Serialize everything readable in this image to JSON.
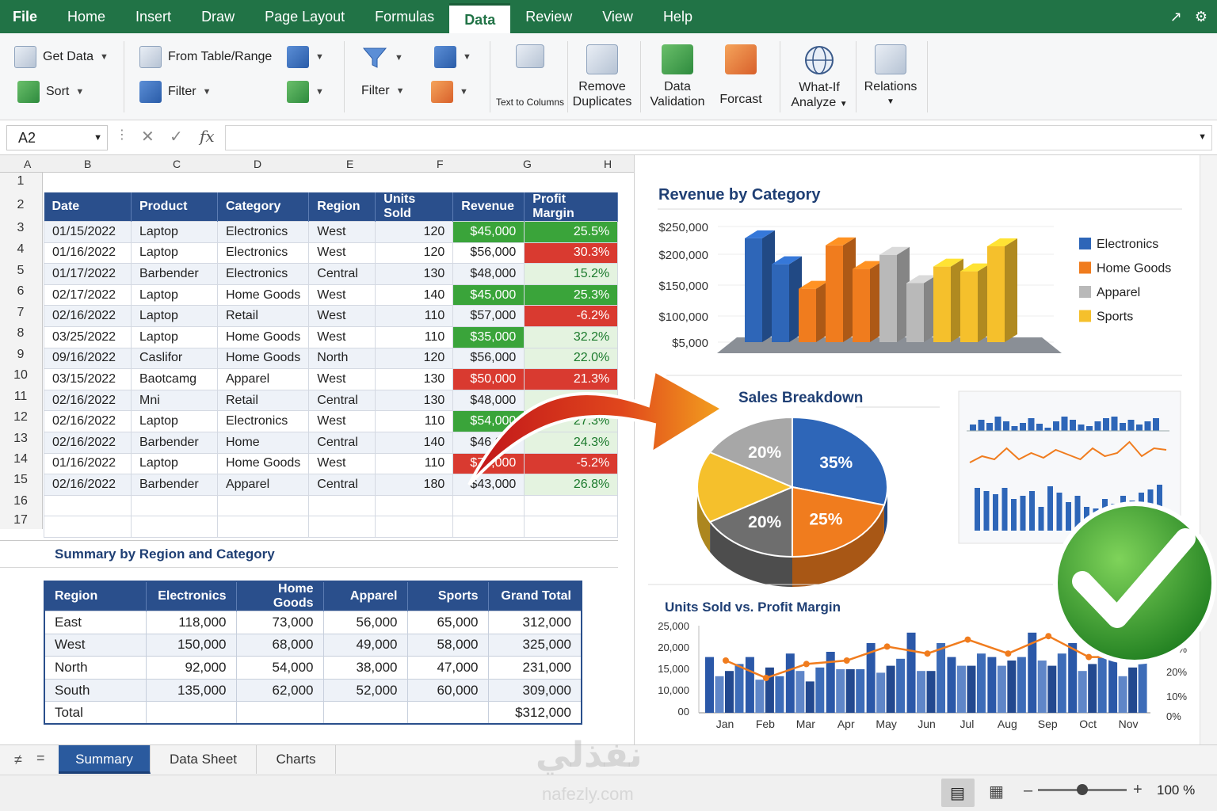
{
  "menu": {
    "tabs": [
      "File",
      "Home",
      "Insert",
      "Draw",
      "Page Layout",
      "Formulas",
      "Data",
      "Review",
      "View",
      "Help"
    ],
    "active": "Data"
  },
  "ribbon": {
    "get_data": "Get Data",
    "sort": "Sort",
    "from_table": "From Table/Range",
    "filter_small": "Filter",
    "filter": "Filter",
    "text_to_columns": "Text to Columns",
    "remove_duplicates_1": "Remove",
    "remove_duplicates_2": "Duplicates",
    "data_validation_1": "Data",
    "data_validation_2": "Validation",
    "forecast": "Forcast",
    "whatif_1": "What-If",
    "whatif_2": "Analyze",
    "relations": "Relations"
  },
  "formula_bar": {
    "name_box": "A2",
    "fx": "fx",
    "formula": ""
  },
  "columns": [
    "A",
    "B",
    "C",
    "D",
    "E",
    "F",
    "G",
    "H"
  ],
  "rows": [
    "1",
    "2",
    "3",
    "4",
    "5",
    "6",
    "7",
    "8",
    "9",
    "10",
    "11",
    "12",
    "13",
    "14",
    "15",
    "16",
    "17"
  ],
  "data_table": {
    "headers": [
      "Date",
      "Product",
      "Category",
      "Region",
      "Units Sold",
      "Revenue",
      "Profit Margin"
    ],
    "rows": [
      [
        "01/15/2022",
        "Laptop",
        "Electronics",
        "West",
        "120",
        "$45,000",
        "25.5%"
      ],
      [
        "01/16/2022",
        "Laptop",
        "Electronics",
        "West",
        "120",
        "$56,000",
        "30.3%"
      ],
      [
        "01/17/2022",
        "Barbender",
        "Electronics",
        "Central",
        "130",
        "$48,000",
        "15.2%"
      ],
      [
        "02/17/2022",
        "Laptop",
        "Home Goods",
        "West",
        "140",
        "$45,000",
        "25.3%"
      ],
      [
        "02/16/2022",
        "Laptop",
        "Retail",
        "West",
        "110",
        "$57,000",
        "-6.2%"
      ],
      [
        "03/25/2022",
        "Laptop",
        "Home Goods",
        "West",
        "110",
        "$35,000",
        "32.2%"
      ],
      [
        "09/16/2022",
        "Caslifor",
        "Home Goods",
        "North",
        "120",
        "$56,000",
        "22.0%"
      ],
      [
        "03/15/2022",
        "Baotcamg",
        "Apparel",
        "West",
        "130",
        "$50,000",
        "21.3%"
      ],
      [
        "02/16/2022",
        "Mni",
        "Retail",
        "Central",
        "130",
        "$48,000",
        "25.5%"
      ],
      [
        "02/16/2022",
        "Laptop",
        "Electronics",
        "West",
        "110",
        "$54,000",
        "27.3%"
      ],
      [
        "02/16/2022",
        "Barbender",
        "Home",
        "Central",
        "140",
        "$46,000",
        "24.3%"
      ],
      [
        "01/16/2022",
        "Laptop",
        "Home Goods",
        "West",
        "110",
        "$70,000",
        "-5.2%"
      ],
      [
        "02/16/2022",
        "Barbender",
        "Apparel",
        "Central",
        "180",
        "$43,000",
        "26.8%"
      ]
    ]
  },
  "summary": {
    "title": "Summary by Region and Category",
    "headers": [
      "Region",
      "Electronics",
      "Home Goods",
      "Apparel",
      "Sports",
      "Grand Total"
    ],
    "rows": [
      [
        "East",
        "118,000",
        "73,000",
        "56,000",
        "65,000",
        "312,000"
      ],
      [
        "West",
        "150,000",
        "68,000",
        "49,000",
        "58,000",
        "325,000"
      ],
      [
        "North",
        "92,000",
        "54,000",
        "38,000",
        "47,000",
        "231,000"
      ],
      [
        "South",
        "135,000",
        "62,000",
        "52,000",
        "60,000",
        "309,000"
      ],
      [
        "Total",
        "",
        "",
        "",
        "",
        "$312,000"
      ]
    ]
  },
  "charts": {
    "revenue_title": "Revenue by Category",
    "pie_title": "Sales Breakdown",
    "combo_title": "Units Sold vs. Profit Margin"
  },
  "chart_data": [
    {
      "type": "bar",
      "title": "Revenue by Category",
      "y_ticks": [
        "$250,000",
        "$200,000",
        "$150,000",
        "$100,000",
        "$5,000"
      ],
      "series": [
        {
          "name": "Electronics",
          "values": [
            215000,
            160000
          ]
        },
        {
          "name": "Home Goods",
          "values": [
            108000,
            200000,
            150000
          ]
        },
        {
          "name": "Apparel",
          "values": [
            180000,
            120000
          ]
        },
        {
          "name": "Sports",
          "values": [
            155000,
            145000,
            198000
          ]
        }
      ],
      "bar_order": [
        {
          "series": "Electronics",
          "value": 215000
        },
        {
          "series": "Electronics",
          "value": 160000
        },
        {
          "series": "Home Goods",
          "value": 108000
        },
        {
          "series": "Home Goods",
          "value": 200000
        },
        {
          "series": "Home Goods",
          "value": 150000
        },
        {
          "series": "Apparel",
          "value": 180000
        },
        {
          "series": "Apparel",
          "value": 120000
        },
        {
          "series": "Sports",
          "value": 155000
        },
        {
          "series": "Sports",
          "value": 145000
        },
        {
          "series": "Sports",
          "value": 198000
        }
      ],
      "colors": {
        "Electronics": "#2e66b8",
        "Home Goods": "#f07c1e",
        "Apparel": "#b9b9b9",
        "Sports": "#f5c02c"
      },
      "legend_position": "right"
    },
    {
      "type": "pie",
      "title": "Sales Breakdown",
      "slices": [
        {
          "label": "35%",
          "value": 35,
          "color": "#2e66b8"
        },
        {
          "label": "25%",
          "value": 25,
          "color": "#f07c1e"
        },
        {
          "label": "20%",
          "value": 20,
          "color": "#6e6e6e"
        },
        {
          "label": "",
          "value": 20,
          "color": "#f5c02c"
        },
        {
          "label": "20%",
          "value": 20,
          "color": "#a7a7a7"
        }
      ]
    },
    {
      "type": "bar",
      "title": "Units Sold vs. Profit Margin",
      "categories": [
        "Jan",
        "Feb",
        "Mar",
        "Apr",
        "May",
        "Jun",
        "Jul",
        "Aug",
        "Sep",
        "Oct",
        "Nov"
      ],
      "y_ticks": [
        "25,000",
        "20,000",
        "15,000",
        "10,000",
        "00"
      ],
      "y2_ticks": [
        "30%",
        "30%",
        "20%",
        "10%",
        "0%"
      ],
      "ylim": [
        0,
        25000
      ],
      "series": [
        {
          "values": [
            16000,
            16000,
            17000,
            17500,
            20000,
            23000,
            16000,
            16000,
            23000,
            20000,
            16000
          ]
        },
        {
          "values": [
            10500,
            9500,
            12000,
            12500,
            11500,
            12000,
            13500,
            13500,
            15000,
            12000,
            10500
          ]
        },
        {
          "values": [
            12000,
            13000,
            9000,
            12500,
            13500,
            12000,
            13500,
            15000,
            13500,
            14000,
            13000
          ]
        },
        {
          "values": [
            14000,
            10500,
            13000,
            12500,
            15500,
            20000,
            17000,
            16000,
            17000,
            17000,
            16000
          ]
        }
      ],
      "line": [
        15000,
        10000,
        14000,
        15000,
        19000,
        17000,
        21000,
        17000,
        22000,
        16000,
        16000
      ]
    }
  ],
  "sheets": {
    "tabs": [
      "Summary",
      "Data Sheet",
      "Charts"
    ],
    "active": "Summary"
  },
  "status": {
    "zoom": "100 %",
    "zoom_level": 0.5
  },
  "watermark": {
    "arabic": "نفذلي",
    "latin": "nafezly.com"
  },
  "colors": {
    "excel_green": "#217346",
    "header_blue": "#2a4f8c",
    "good": "#3aa43a",
    "bad": "#d93a30"
  }
}
